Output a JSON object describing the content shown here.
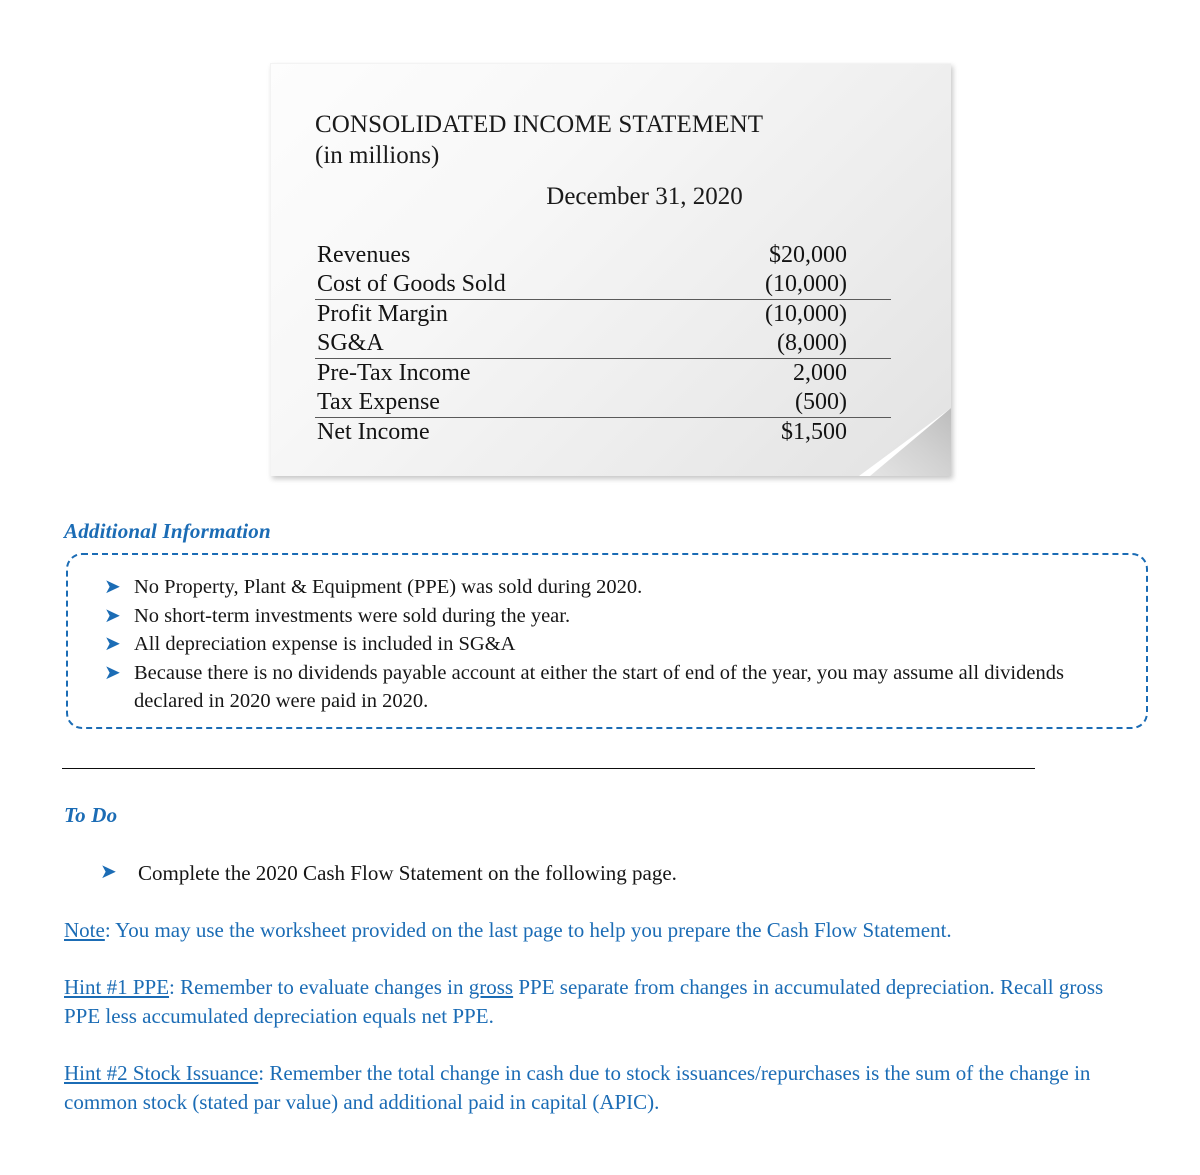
{
  "income_statement": {
    "title": "CONSOLIDATED INCOME STATEMENT",
    "units": "(in millions)",
    "date": "December 31, 2020",
    "rows": [
      {
        "label": "Revenues",
        "value": "$20,000",
        "rule": false
      },
      {
        "label": "Cost of Goods Sold",
        "value": "(10,000)",
        "rule": true
      },
      {
        "label": "Profit Margin",
        "value": "(10,000)",
        "rule": false
      },
      {
        "label": "SG&A",
        "value": "(8,000)",
        "rule": true
      },
      {
        "label": "Pre-Tax Income",
        "value": "2,000",
        "rule": false
      },
      {
        "label": "Tax Expense",
        "value": "(500)",
        "rule": true
      },
      {
        "label": "Net Income",
        "value": "$1,500",
        "rule": false
      }
    ]
  },
  "additional_information": {
    "heading": "Additional Information",
    "bullet_glyph": "➤",
    "items": [
      "No Property, Plant & Equipment (PPE) was sold during 2020.",
      "No short-term investments were sold during the year.",
      "All depreciation expense is included in SG&A",
      "Because there is no dividends payable account at either the start of end of the year, you may assume all dividends declared in 2020 were paid in 2020."
    ]
  },
  "to_do": {
    "heading": "To Do",
    "items": [
      "Complete the 2020 Cash Flow Statement on the following page."
    ]
  },
  "notes": {
    "note": {
      "label": "Note",
      "text": ": You may use the worksheet provided on the last page to help you prepare the Cash Flow Statement."
    },
    "hint1": {
      "label": "Hint #1 PPE",
      "text_before": ": Remember to evaluate changes in ",
      "emphasis": "gross",
      "text_after": " PPE separate from changes in accumulated depreciation. Recall gross PPE less accumulated depreciation equals net PPE."
    },
    "hint2": {
      "label": "Hint #2 Stock Issuance",
      "text": ": Remember the total change in cash due to stock issuances/repurchases is the sum of the change in common stock (stated par value) and additional paid in capital (APIC)."
    }
  },
  "colors": {
    "accent_blue": "#1b6cb5",
    "body_black": "#141414",
    "rule": "#5a5a5a"
  }
}
